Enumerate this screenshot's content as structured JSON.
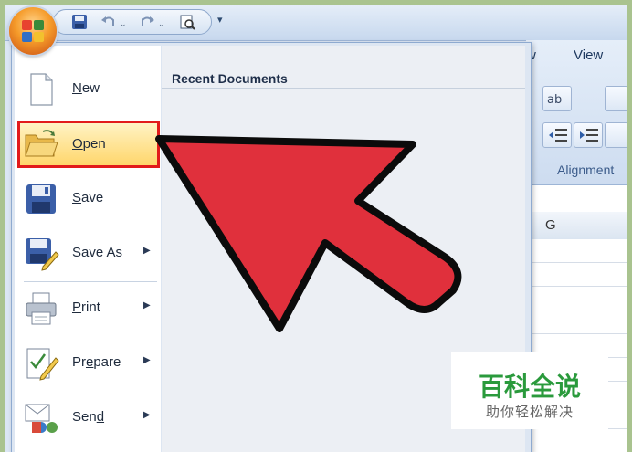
{
  "ribbon": {
    "tabs": [
      "w",
      "View"
    ],
    "group_label": "Alignment"
  },
  "sheet": {
    "column_label": "G"
  },
  "office_menu": {
    "recent_title": "Recent Documents",
    "items": [
      {
        "label": "New",
        "key": "N",
        "rest": "ew",
        "submenu": false,
        "icon": "new-document-icon"
      },
      {
        "label": "Open",
        "key": "O",
        "rest": "pen",
        "submenu": false,
        "icon": "open-folder-icon",
        "highlighted": true
      },
      {
        "label": "Save",
        "key": "S",
        "rest": "ave",
        "submenu": false,
        "icon": "save-disk-icon"
      },
      {
        "label": "Save As",
        "pre": "Save ",
        "key": "A",
        "rest": "s",
        "submenu": true,
        "icon": "save-as-icon"
      },
      {
        "label": "Print",
        "key": "P",
        "rest": "rint",
        "submenu": true,
        "icon": "printer-icon"
      },
      {
        "label": "Prepare",
        "pre": "Pr",
        "key": "e",
        "rest": "pare",
        "submenu": true,
        "icon": "prepare-icon"
      },
      {
        "label": "Send",
        "pre": "Sen",
        "key": "d",
        "rest": "",
        "submenu": true,
        "icon": "send-icon"
      }
    ]
  },
  "watermark": {
    "title": "百科全说",
    "subtitle": "助你轻松解决"
  },
  "colors": {
    "highlight_border": "#e21b1b",
    "arrow_fill": "#e0303c",
    "watermark_green": "#2a9a3c"
  }
}
